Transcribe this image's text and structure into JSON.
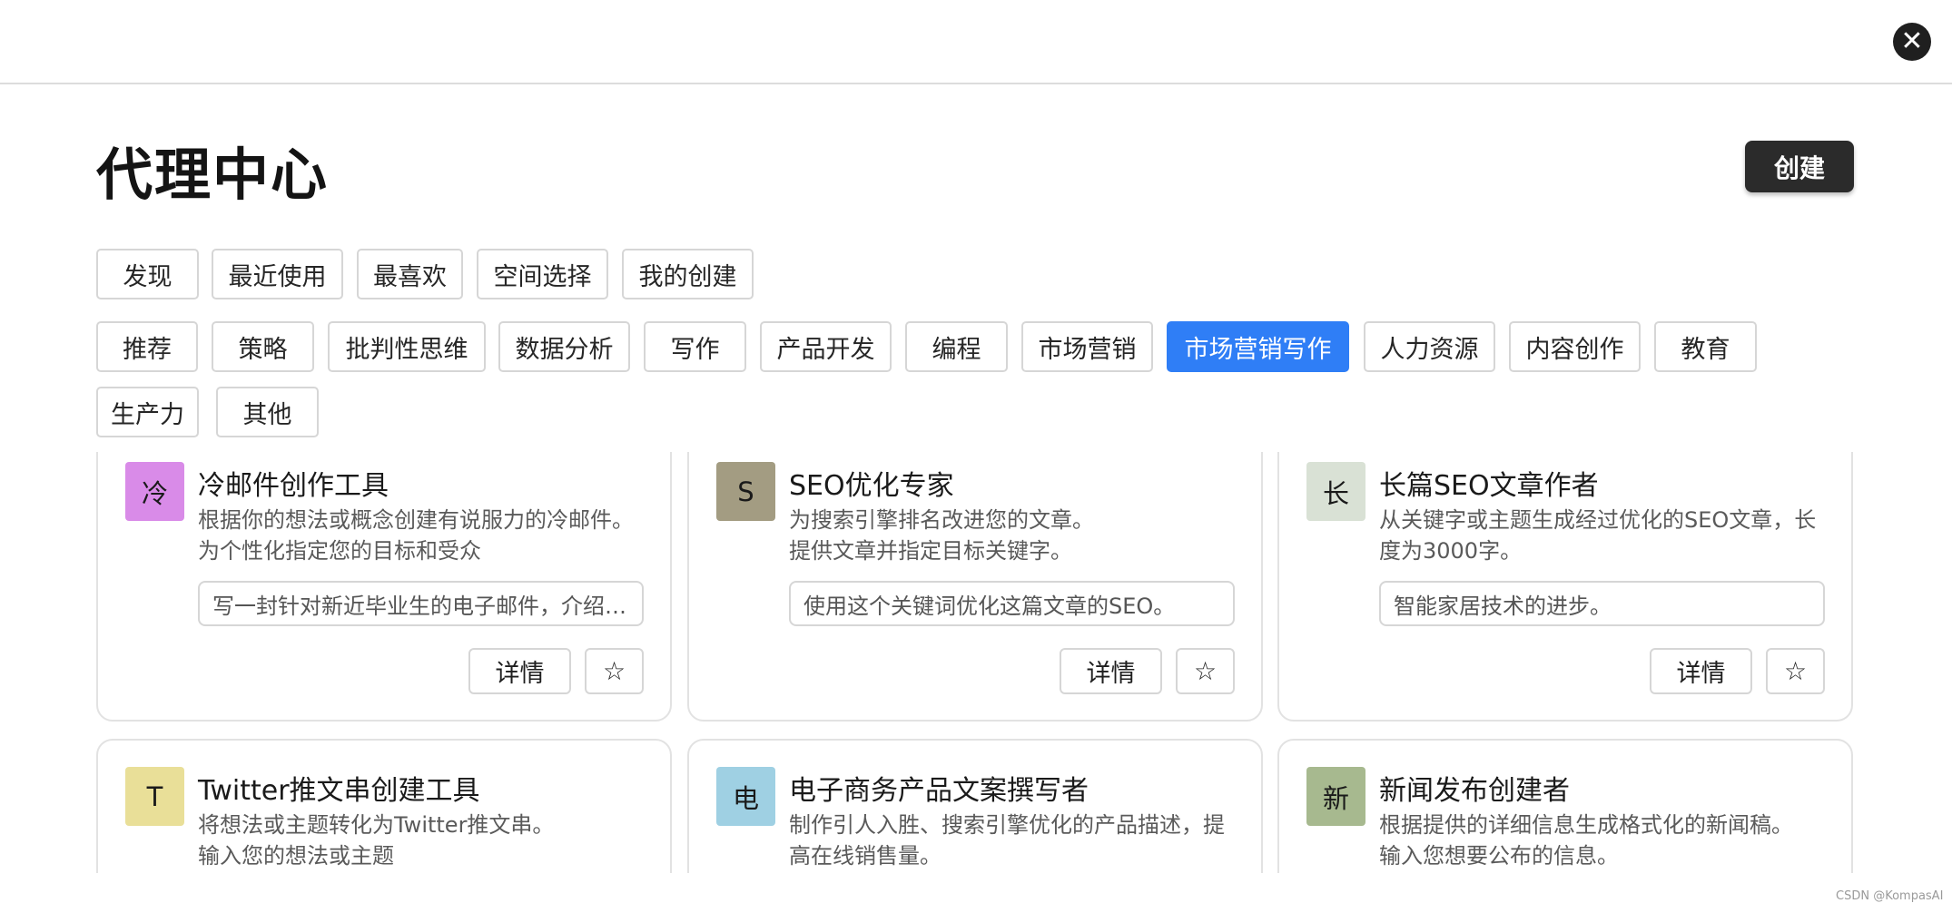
{
  "header": {
    "close_glyph": "✕"
  },
  "page": {
    "title": "代理中心",
    "create_label": "创建"
  },
  "tabs": [
    {
      "label": "发现",
      "active": true
    },
    {
      "label": "最近使用",
      "active": false
    },
    {
      "label": "最喜欢",
      "active": false
    },
    {
      "label": "空间选择",
      "active": false
    },
    {
      "label": "我的创建",
      "active": false
    }
  ],
  "categories": [
    {
      "label": "推荐",
      "active": false
    },
    {
      "label": "策略",
      "active": false
    },
    {
      "label": "批判性思维",
      "active": false
    },
    {
      "label": "数据分析",
      "active": false
    },
    {
      "label": "写作",
      "active": false
    },
    {
      "label": "产品开发",
      "active": false
    },
    {
      "label": "编程",
      "active": false
    },
    {
      "label": "市场营销",
      "active": false
    },
    {
      "label": "市场营销写作",
      "active": true
    },
    {
      "label": "人力资源",
      "active": false
    },
    {
      "label": "内容创作",
      "active": false
    },
    {
      "label": "教育",
      "active": false
    },
    {
      "label": "生产力",
      "active": false
    },
    {
      "label": "其他",
      "active": false
    }
  ],
  "colors": {
    "accent": "#2f7ef6",
    "dark_button": "#2b2b2b"
  },
  "cards": [
    {
      "icon_char": "冷",
      "icon_color": "#d98be8",
      "title": "冷邮件创作工具",
      "desc_lines": [
        "根据你的想法或概念创建有说服力的冷邮件。",
        "为个性化指定您的目标和受众"
      ],
      "example": "写一封针对新近毕业生的电子邮件，介绍我们的职业辅导服务",
      "detail_label": "详情",
      "star_glyph": "☆"
    },
    {
      "icon_char": "S",
      "icon_color": "#a39c82",
      "title": "SEO优化专家",
      "desc_lines": [
        "为搜索引擎排名改进您的文章。",
        "提供文章并指定目标关键字。"
      ],
      "example": "使用这个关键词优化这篇文章的SEO。",
      "detail_label": "详情",
      "star_glyph": "☆"
    },
    {
      "icon_char": "长",
      "icon_color": "#d9e1d5",
      "title": "长篇SEO文章作者",
      "desc_lines": [
        "从关键字或主题生成经过优化的SEO文章，长",
        "度为3000字。"
      ],
      "example": "智能家居技术的进步。",
      "detail_label": "详情",
      "star_glyph": "☆"
    },
    {
      "icon_char": "T",
      "icon_color": "#e9df98",
      "title": "Twitter推文串创建工具",
      "desc_lines": [
        "将想法或主题转化为Twitter推文串。",
        "输入您的想法或主题"
      ]
    },
    {
      "icon_char": "电",
      "icon_color": "#9fd0e3",
      "title": "电子商务产品文案撰写者",
      "desc_lines": [
        "制作引人入胜、搜索引擎优化的产品描述，提",
        "高在线销售量。"
      ]
    },
    {
      "icon_char": "新",
      "icon_color": "#a7b98f",
      "title": "新闻发布创建者",
      "desc_lines": [
        "根据提供的详细信息生成格式化的新闻稿。",
        "输入您想要公布的信息。"
      ]
    }
  ],
  "watermark": "CSDN @KompasAI"
}
